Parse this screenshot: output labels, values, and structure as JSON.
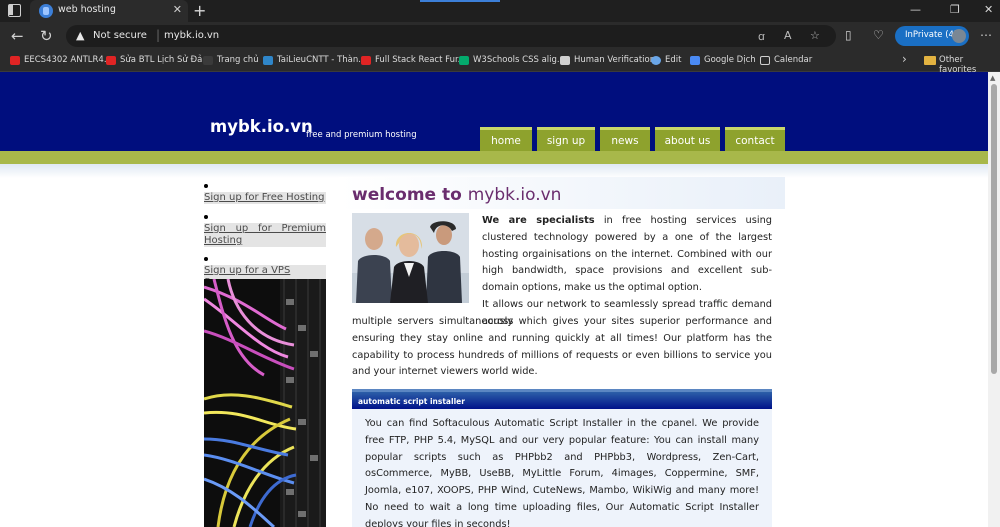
{
  "browser": {
    "tab_title": "web hosting",
    "address": {
      "security_label": "Not secure",
      "url": "mybk.io.vn"
    },
    "profile_label": "InPrivate (4)",
    "bookmarks": [
      "EECS4302 ANTLR4...",
      "Sửa BTL Lịch Sử Đả...",
      "Trang chủ",
      "TaiLieuCNTT - Thàn...",
      "Full Stack React Fur...",
      "W3Schools CSS alig...",
      "Human Verification",
      "Edit",
      "Google Dịch",
      "Calendar"
    ],
    "other_favorites": "Other favorites"
  },
  "site": {
    "title": "mybk.io.vn",
    "tagline": "free and premium hosting",
    "nav": [
      "home",
      "sign up",
      "news",
      "about us",
      "contact"
    ],
    "sidebar_links": [
      "Sign up for Free Hosting",
      "Sign up for Premium Hosting",
      "Sign up for a VPS Server"
    ],
    "welcome_word": "welcome to",
    "welcome_site": "mybk.io.vn",
    "intro_bold": "We are specialists",
    "intro_text": " in free hosting services using clustered technology powered by a one of the largest hosting orgainisations on the internet. Combined with our high bandwidth, space provisions and excellent sub-domain options, make us the optimal option.",
    "para2_top": "It allows our network to seamlessly spread traffic demand across",
    "para2_rest": "multiple servers simultaneously which gives your sites superior performance and ensuring they stay online and running quickly at all times! Our platform has the capability to process hundreds of millions of requests or even billions to service you and your internet viewers world wide.",
    "installer_title": "automatic script installer",
    "installer_text": "You can find Softaculous Automatic Script Installer in the cpanel. We provide free FTP, PHP 5.4, MySQL and our very popular feature: You can install many popular scripts such as PHPbb2 and PHPbb3, Wordpress, Zen-Cart, osCommerce, MyBB, UseBB, MyLittle Forum, 4images, Coppermine, SMF, Joomla, e107, XOOPS, PHP Wind, CuteNews, Mambo, WikiWig and many more! No need to wait a long time uploading files, Our Automatic Script Installer deploys your files in seconds!"
  },
  "icons": [
    "window-icon",
    "site-favicon",
    "close-icon",
    "plus-icon",
    "back-icon",
    "reload-icon",
    "warning-icon",
    "read-aloud-icon",
    "text-size-icon",
    "star-icon",
    "split-screen-icon",
    "favorites-icon",
    "collections-icon",
    "more-icon"
  ],
  "colors": {
    "header_blue": "#000e7e",
    "nav_green": "#8ea22d",
    "strip_green": "#a8b84a",
    "welcome_purple": "#6a2d6e",
    "inprivate_blue": "#1a6fc4"
  }
}
